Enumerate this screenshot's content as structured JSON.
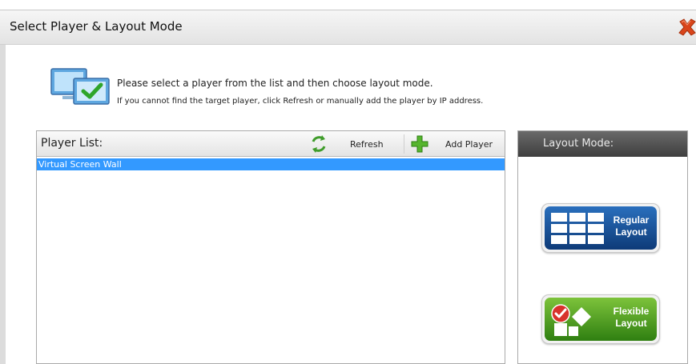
{
  "window": {
    "title": "Select Player & Layout Mode"
  },
  "intro": {
    "line1": "Please select a player from the list and then choose layout mode.",
    "line2": "If you cannot find the target player, click Refresh or manually add the player by IP address."
  },
  "player_list": {
    "title": "Player List:",
    "refresh_label": "Refresh",
    "add_player_label": "Add Player",
    "items": [
      {
        "label": "Virtual Screen Wall",
        "selected": true
      }
    ]
  },
  "layout_mode": {
    "title": "Layout Mode:",
    "regular": {
      "line1": "Regular",
      "line2": "Layout"
    },
    "flexible": {
      "line1": "Flexible",
      "line2": "Layout"
    }
  },
  "icons": [
    "close-icon",
    "monitor-check-icon",
    "refresh-icon",
    "add-icon",
    "grid-layout-icon",
    "flexible-layout-icon"
  ],
  "colors": {
    "selection": "#3399ff",
    "regular_button": "#1a4f93",
    "flexible_button": "#4a9a1e",
    "close": "#d9451b"
  }
}
